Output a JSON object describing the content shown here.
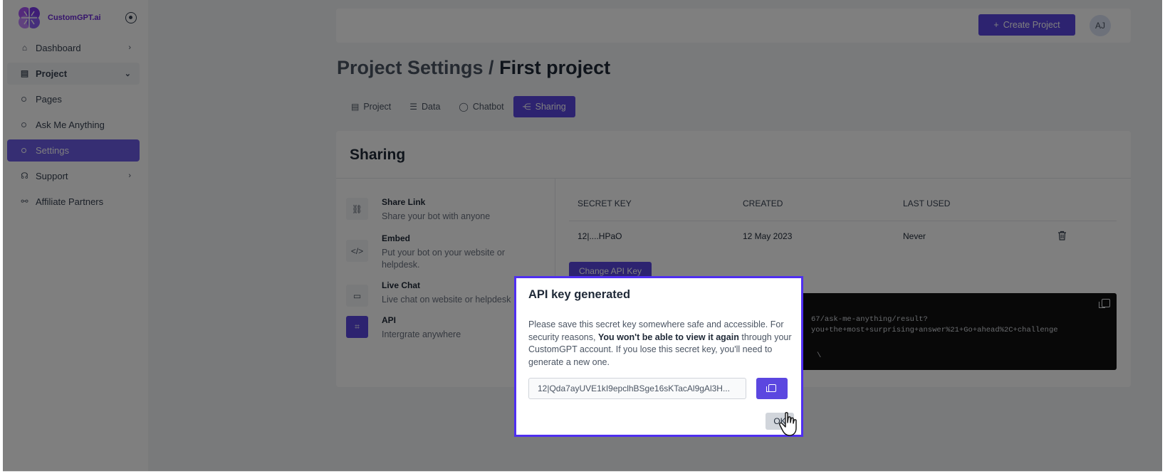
{
  "app": {
    "name": "CustomGPT.ai"
  },
  "sidebar": {
    "items": [
      {
        "label": "Dashboard"
      },
      {
        "label": "Project"
      },
      {
        "label": "Pages"
      },
      {
        "label": "Ask Me Anything"
      },
      {
        "label": "Settings"
      },
      {
        "label": "Support"
      },
      {
        "label": "Affiliate Partners"
      }
    ]
  },
  "header": {
    "create_label": "Create Project",
    "avatar_initials": "AJ"
  },
  "page": {
    "title_prefix": "Project Settings /",
    "title_project": "First project"
  },
  "tabs": [
    {
      "label": "Project"
    },
    {
      "label": "Data"
    },
    {
      "label": "Chatbot"
    },
    {
      "label": "Sharing"
    }
  ],
  "sharing": {
    "title": "Sharing",
    "options": [
      {
        "title": "Share Link",
        "desc": "Share your bot with anyone"
      },
      {
        "title": "Embed",
        "desc": "Put your bot on your website or helpdesk."
      },
      {
        "title": "Live Chat",
        "desc": "Live chat on website or helpdesk"
      },
      {
        "title": "API",
        "desc": "Intergrate anywhere"
      }
    ],
    "table": {
      "headers": [
        "SECRET KEY",
        "CREATED",
        "LAST USED"
      ],
      "rows": [
        {
          "key": "12|....HPaO",
          "created": "12 May 2023",
          "last_used": "Never"
        }
      ]
    },
    "change_key_label": "Change API Key",
    "code_lines": [
      "67/ask-me-anything/result?",
      "you+the+most+surprising+answer%21+Go+ahead%2C+challenge",
      "\\"
    ]
  },
  "modal": {
    "title": "API key generated",
    "body_1": "Please save this secret key somewhere safe and accessible. For security reasons,",
    "body_bold": "You won't be able to view it again",
    "body_2": "through your CustomGPT account. If you lose this secret key, you'll need to generate a new one.",
    "key_value": "12|Qda7ayUVE1kI9epclhBSge16sKTacAl9gAl3H...",
    "ok_label": "OK"
  },
  "colors": {
    "accent": "#5b47e0",
    "modal_border": "#4f2ff0",
    "brand": "#6d28d9"
  }
}
